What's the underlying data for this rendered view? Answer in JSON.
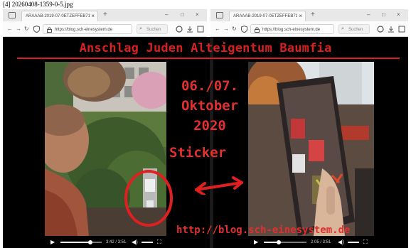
{
  "caption": "[4] 20260408-1359-0-5.jpg",
  "left_browser": {
    "tab_title": "ARAAAB-2019-07-0ETZEFFEB711",
    "url": "https://blog.sch-einesystem.de",
    "search_placeholder": "Suchen"
  },
  "right_browser": {
    "tab_title": "ARAAAB-2019-07-0ETZEFFEB711",
    "url": "https://blog.sch-einesystem.de",
    "search_placeholder": "Suchen"
  },
  "video": {
    "headline": "Anschlag Juden Alteigentum Baumfia",
    "date_line1": "06./07.",
    "date_line2": "Oktober",
    "date_line3": "2020",
    "sticker_label": "Sticker",
    "blog_url": "http://blog.sch-einesystem.de",
    "annotation_color": "#e02020"
  },
  "left_player": {
    "time": "3:42 / 3:51",
    "progress": 0.72
  },
  "right_player": {
    "time": "2:05 / 3:51",
    "progress": 0.35
  },
  "icons": {
    "close": "×",
    "new_tab": "+",
    "minimize": "–",
    "maximize": "□",
    "back": "←",
    "forward": "→",
    "reload": "↻",
    "play": "▶",
    "volume": "◀)",
    "fullscreen": "⛶"
  }
}
